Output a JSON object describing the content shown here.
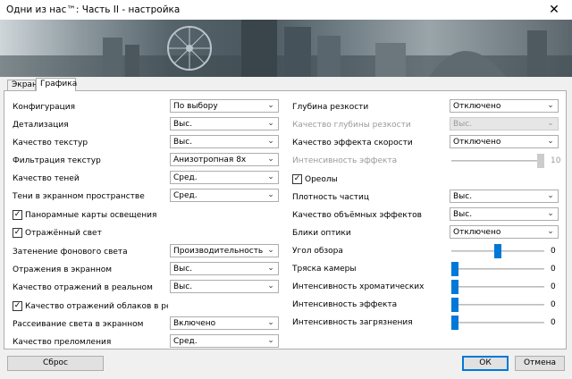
{
  "window": {
    "title": "Одни из нас™: Часть II - настройка",
    "close_glyph": "✕"
  },
  "tabs": [
    {
      "label": "Экран",
      "active": false
    },
    {
      "label": "Графика",
      "active": true
    }
  ],
  "left": {
    "configuration": {
      "label": "Конфигурация",
      "value": "По выбору"
    },
    "detail": {
      "label": "Детализация",
      "value": "Выс."
    },
    "texture_quality": {
      "label": "Качество текстур",
      "value": "Выс."
    },
    "texture_filtering": {
      "label": "Фильтрация текстур",
      "value": "Анизотропная 8x"
    },
    "shadow_quality": {
      "label": "Качество теней",
      "value": "Сред."
    },
    "screen_space_shadows": {
      "label": "Тени в экранном пространстве",
      "value": "Сред."
    },
    "panoramic_light_maps": {
      "label": "Панорамные карты освещения",
      "checked": true
    },
    "reflected_light": {
      "label": "Отражённый свет",
      "checked": true
    },
    "ambient_occlusion": {
      "label": "Затенение фонового света",
      "value": "Производительность"
    },
    "screen_reflections": {
      "label": "Отражения в экранном",
      "value": "Выс."
    },
    "realtime_reflections": {
      "label": "Качество отражений в реальном",
      "value": "Выс."
    },
    "cloud_reflections": {
      "label": "Качество отражений облаков в реальном в",
      "checked": true
    },
    "screen_light_scattering": {
      "label": "Рассеивание света в экранном",
      "value": "Включено"
    },
    "refraction_quality": {
      "label": "Качество преломления",
      "value": "Сред."
    }
  },
  "right": {
    "depth_of_field": {
      "label": "Глубина резкости",
      "value": "Отключено"
    },
    "dof_quality": {
      "label": "Качество глубины резкости",
      "value": "Выс.",
      "disabled": true
    },
    "motion_blur_quality": {
      "label": "Качество эффекта скорости",
      "value": "Отключено"
    },
    "effect_intensity": {
      "label": "Интенсивность эффекта",
      "value": "10",
      "disabled": true,
      "fraction": 1.0
    },
    "halos": {
      "label": "Ореолы",
      "checked": true
    },
    "particle_density": {
      "label": "Плотность частиц",
      "value": "Выс."
    },
    "volumetric_quality": {
      "label": "Качество объёмных эффектов",
      "value": "Выс."
    },
    "lens_flares": {
      "label": "Блики оптики",
      "value": "Отключено"
    },
    "field_of_view": {
      "label": "Угол обзора",
      "value": "0",
      "fraction": 0.5
    },
    "camera_shake": {
      "label": "Тряска камеры",
      "value": "0",
      "fraction": 0.0
    },
    "chromatic_intensity": {
      "label": "Интенсивность хроматических",
      "value": "0",
      "fraction": 0.0
    },
    "effect_intensity_2": {
      "label": "Интенсивность эффекта",
      "value": "0",
      "fraction": 0.0
    },
    "grain_intensity": {
      "label": "Интенсивность загрязнения",
      "value": "0",
      "fraction": 0.0
    }
  },
  "buttons": {
    "reset": "Сброс",
    "ok": "ОК",
    "cancel": "Отмена"
  },
  "colors": {
    "accent": "#0078d7",
    "panel": "#ffffff",
    "window": "#f0f0f0"
  }
}
